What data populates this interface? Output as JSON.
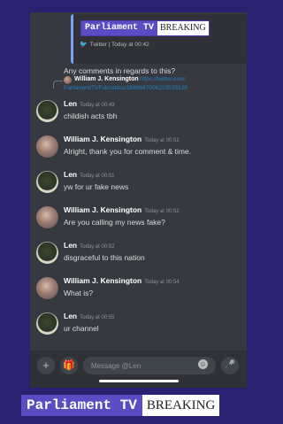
{
  "embed": {
    "logo_left": "Parliament TV",
    "logo_right": "BREAKING",
    "footer": "Twitter | Today at 00:42"
  },
  "reply_text": "Any comments in regards to this?",
  "reply_ref": {
    "name": "William J. Kensington",
    "link_part1": "https://twitter.com/",
    "link_part2": "ParliamentTVFuk/status/1688697006223535128"
  },
  "messages": [
    {
      "user": "Len",
      "time": "Today at 00:49",
      "text": "childish acts tbh"
    },
    {
      "user": "William J. Kensington",
      "time": "Today at 00:51",
      "text": "Alright, thank you for comment & time."
    },
    {
      "user": "Len",
      "time": "Today at 00:51",
      "text": "yw for ur fake news"
    },
    {
      "user": "William J. Kensington",
      "time": "Today at 00:52",
      "text": "Are you calling my news fake?"
    },
    {
      "user": "Len",
      "time": "Today at 00:52",
      "text": "disgraceful to this nation"
    },
    {
      "user": "William J. Kensington",
      "time": "Today at 00:54",
      "text": "What is?"
    },
    {
      "user": "Len",
      "time": "Today at 00:55",
      "text": "ur channel"
    }
  ],
  "input": {
    "placeholder": "Message @Len"
  },
  "icons": {
    "plus": "plus-icon",
    "gift": "gift-icon",
    "emoji": "emoji-icon",
    "mic": "mic-icon",
    "twitter": "twitter-icon"
  },
  "watermark": {
    "left": "Parliament TV",
    "right": "BREAKING"
  }
}
